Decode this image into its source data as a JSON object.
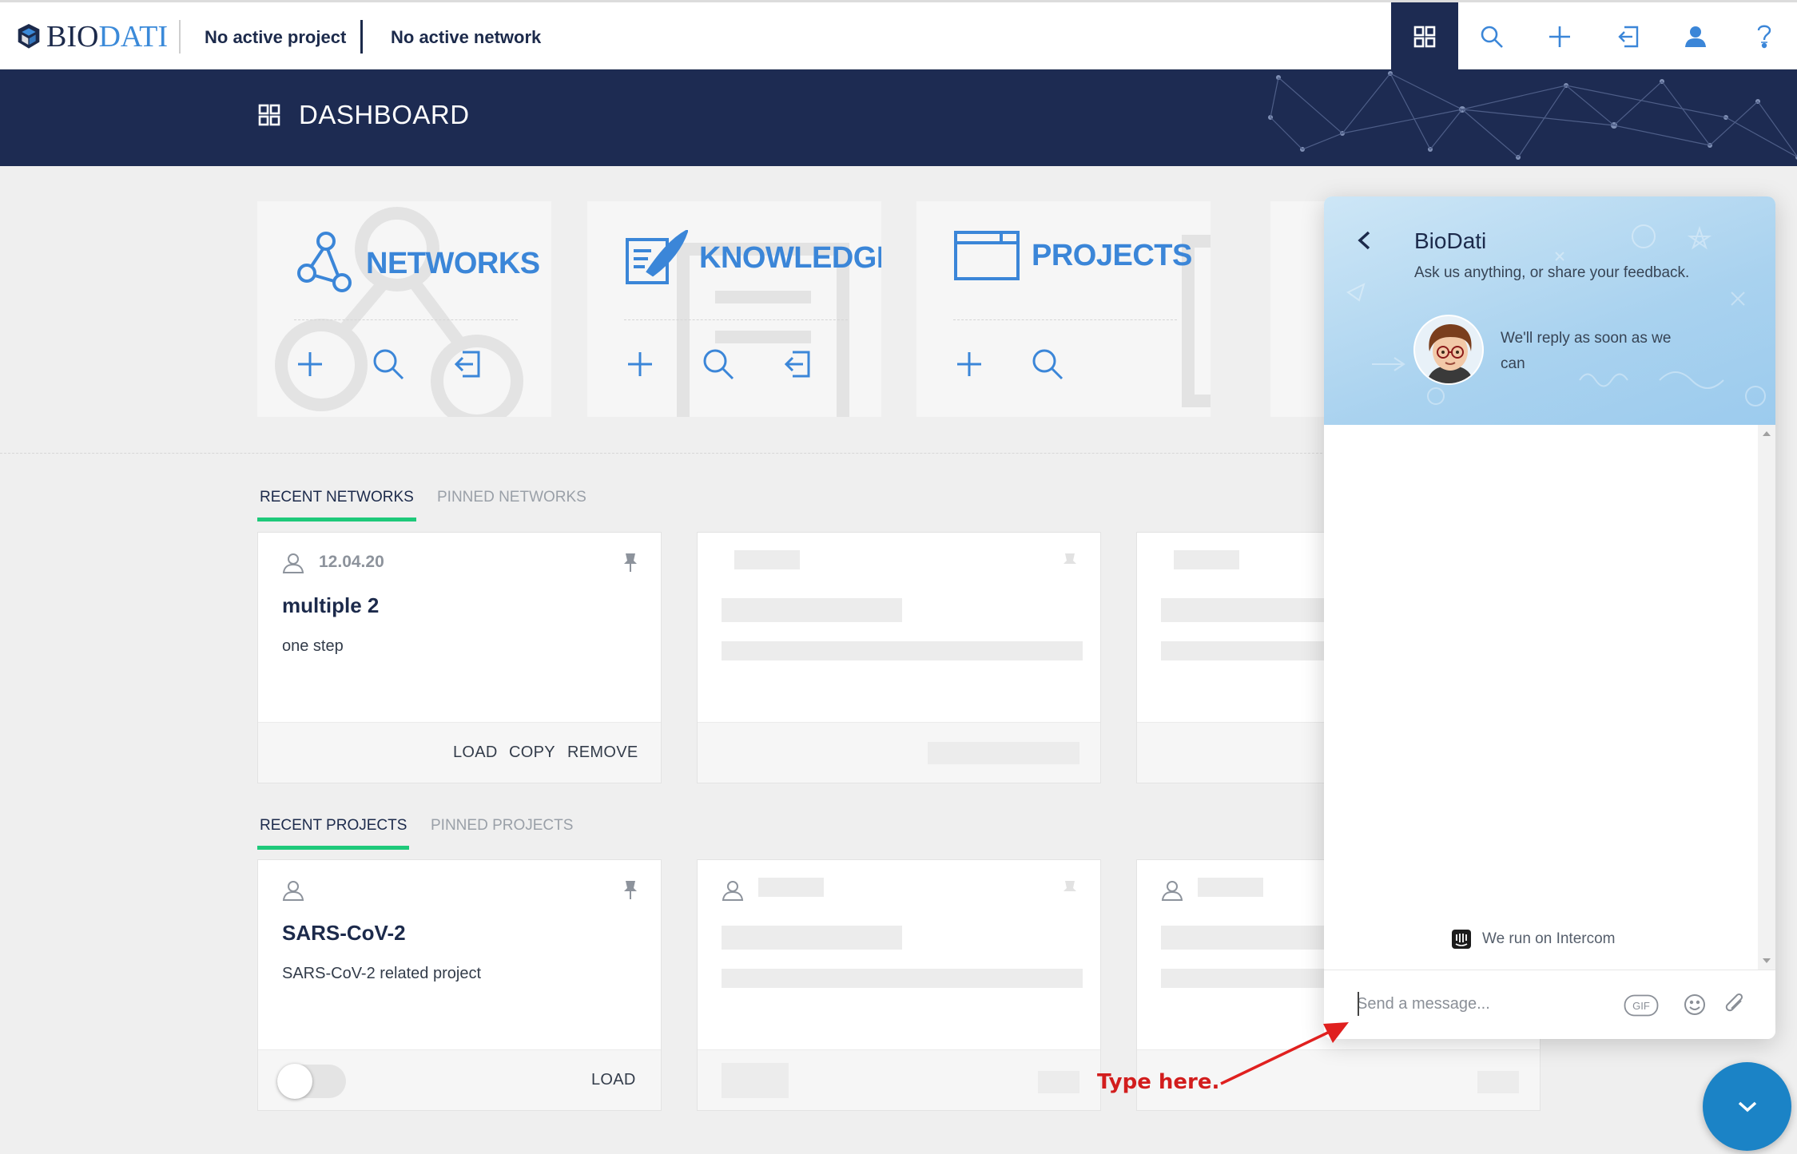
{
  "topbar": {
    "logo_bio": "BIO",
    "logo_dati": "DATI",
    "project_label": "No active project",
    "network_label": "No active network",
    "actions": [
      "dashboard-icon",
      "search-icon",
      "plus-icon",
      "import-icon",
      "user-icon",
      "help-icon"
    ],
    "active_action": "dashboard-icon"
  },
  "header": {
    "title": "DASHBOARD"
  },
  "categories": {
    "networks": {
      "title": "NETWORKS",
      "actions": [
        "plus-icon",
        "search-icon",
        "import-icon"
      ]
    },
    "knowledge": {
      "title": "KNOWLEDGE",
      "actions": [
        "plus-icon",
        "search-icon",
        "import-icon"
      ]
    },
    "projects": {
      "title": "PROJECTS",
      "actions": [
        "plus-icon",
        "search-icon"
      ]
    }
  },
  "network_tabs": {
    "recent": "RECENT NETWORKS",
    "pinned": "PINNED NETWORKS"
  },
  "network_card": {
    "date": "12.04.20",
    "title": "multiple 2",
    "description": "one step",
    "load": "LOAD",
    "copy": "COPY",
    "remove": "REMOVE"
  },
  "project_tabs": {
    "recent": "RECENT PROJECTS",
    "pinned": "PINNED PROJECTS"
  },
  "project_card": {
    "title": "SARS-CoV-2",
    "description": "SARS-CoV-2 related project",
    "load": "LOAD",
    "toggle_on": false
  },
  "chat": {
    "name": "BioDati",
    "subtitle": "Ask us anything, or share your feedback.",
    "reply_time": "We'll reply as soon as we can",
    "powered_by": "We run on Intercom",
    "input_placeholder": "Send a message...",
    "gif_label": "GIF"
  },
  "annotation": {
    "text": "Type here."
  },
  "colors": {
    "navy": "#1d2b52",
    "accent_blue": "#3b86d8",
    "tab_underline": "#1ec97a",
    "annotation_red": "#d21d1d",
    "chat_fab": "#1b83c6"
  }
}
